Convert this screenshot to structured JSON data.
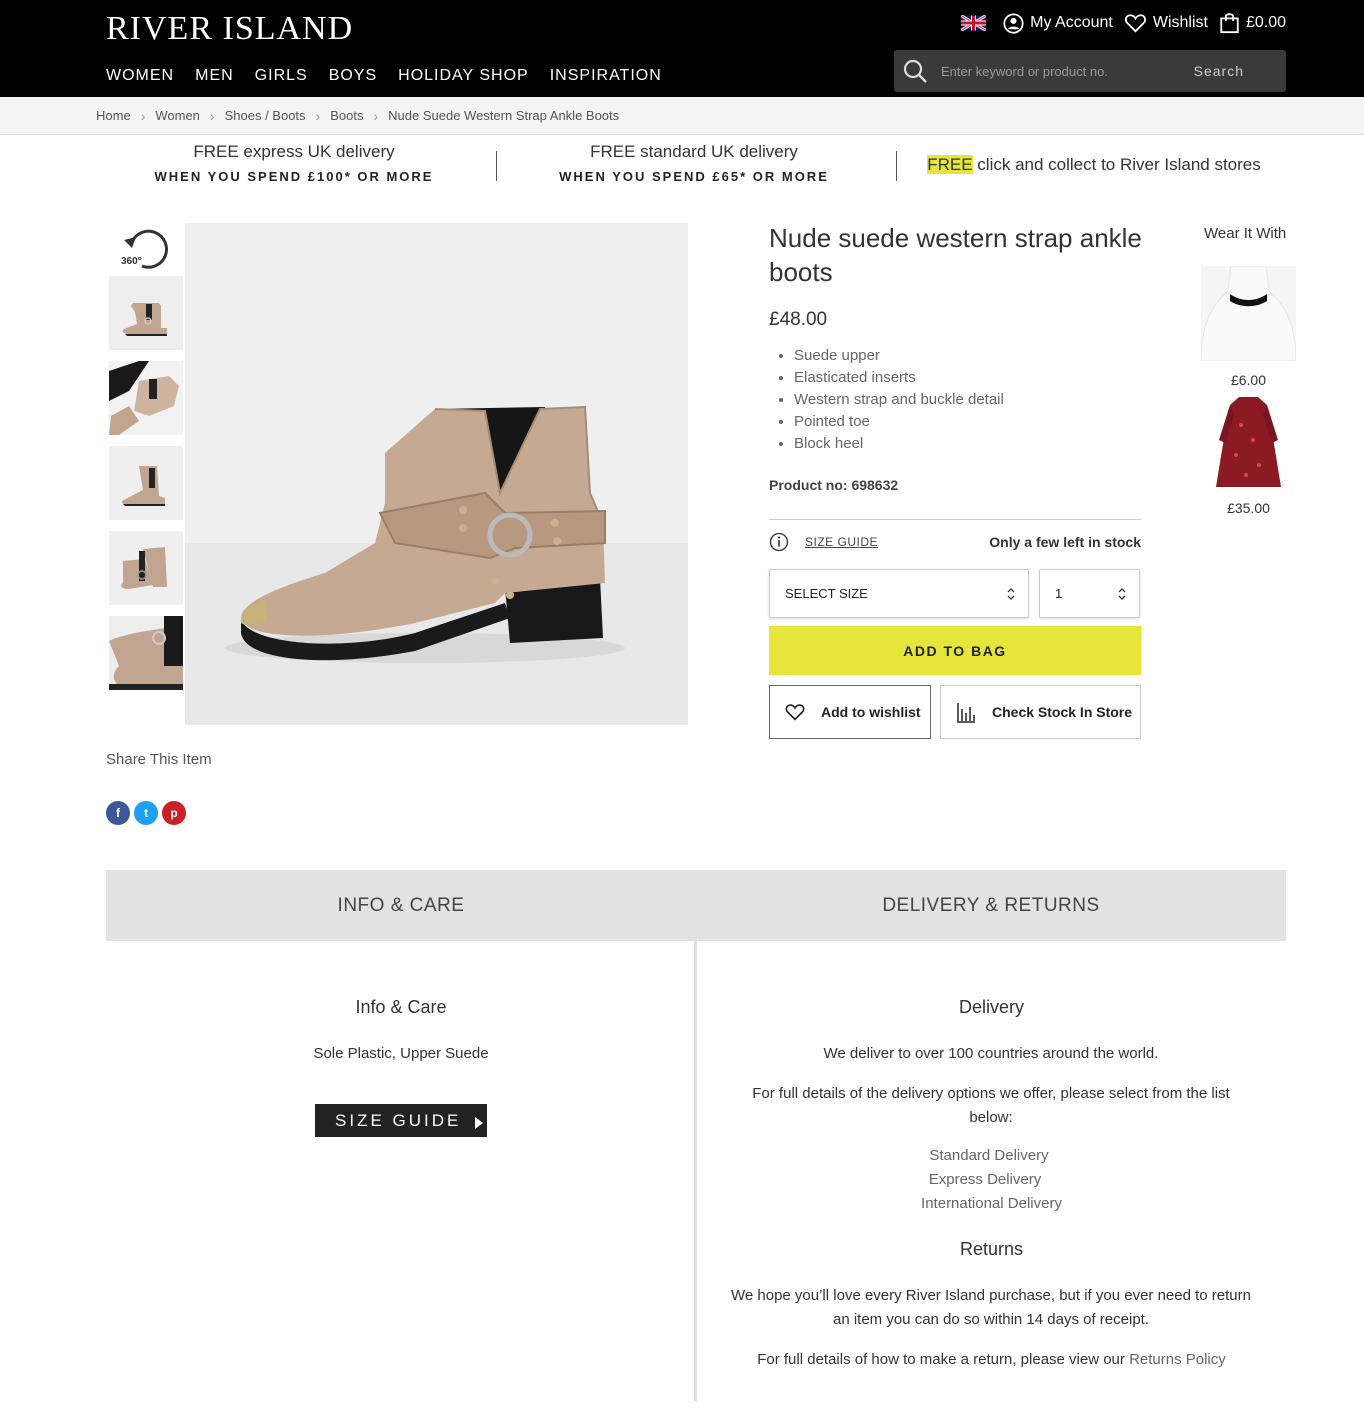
{
  "header": {
    "logo": "RIVER ISLAND",
    "nav": [
      "WOMEN",
      "MEN",
      "GIRLS",
      "BOYS",
      "HOLIDAY SHOP",
      "INSPIRATION"
    ],
    "account_label": "My Account",
    "wishlist_label": "Wishlist",
    "bag_total": "£0.00",
    "search_placeholder": "Enter keyword or product no.",
    "search_button": "Search"
  },
  "breadcrumb": [
    "Home",
    "Women",
    "Shoes / Boots",
    "Boots",
    "Nude Suede Western Strap Ankle Boots"
  ],
  "promos": [
    {
      "line1": "FREE express UK delivery",
      "line2": "WHEN YOU SPEND £100* OR MORE"
    },
    {
      "line1": "FREE standard UK delivery",
      "line2": "WHEN YOU SPEND £65* OR MORE"
    },
    {
      "highlight": "FREE",
      "line1": " click and collect to River Island stores"
    }
  ],
  "gallery": {
    "rotate_label": "360°"
  },
  "share": {
    "label": "Share This Item",
    "icons": [
      "f",
      "t",
      "p"
    ]
  },
  "product": {
    "title": "Nude suede western strap ankle boots",
    "price": "£48.00",
    "features": [
      "Suede upper",
      "Elasticated inserts",
      "Western strap and buckle detail",
      "Pointed toe",
      "Block heel"
    ],
    "product_no_label": "Product no:",
    "product_no": "698632",
    "size_guide_label": "SIZE GUIDE",
    "stock_label": "Only a few left in stock",
    "size_select": "SELECT SIZE",
    "quantity": "1",
    "add_to_bag": "ADD TO BAG",
    "add_to_wishlist": "Add to wishlist",
    "check_stock": "Check Stock In Store"
  },
  "wear_it_with": {
    "title": "Wear It With",
    "items": [
      {
        "price": "£6.00"
      },
      {
        "price": "£35.00"
      }
    ]
  },
  "tabs": [
    "INFO & CARE",
    "DELIVERY & RETURNS"
  ],
  "info_care": {
    "heading": "Info & Care",
    "composition": "Sole Plastic, Upper Suede",
    "size_guide_button": "SIZE GUIDE"
  },
  "delivery": {
    "heading": "Delivery",
    "p1": "We deliver to over 100 countries around the world.",
    "p2": "For full details of the delivery options we offer, please select from the list below:",
    "links": [
      "Standard Delivery",
      "Express Delivery",
      "International Delivery"
    ],
    "returns_heading": "Returns",
    "p3": "We hope you’ll love every River Island purchase, but if you ever need to return an item you can do so within 14 days of receipt.",
    "p4_prefix": "For full details of how to make a return, please view our ",
    "p4_link": "Returns Policy"
  },
  "colors": {
    "header_bg": "#000000",
    "accent_yellow": "#e6e63a",
    "tab_bg": "#e2e2e2"
  }
}
